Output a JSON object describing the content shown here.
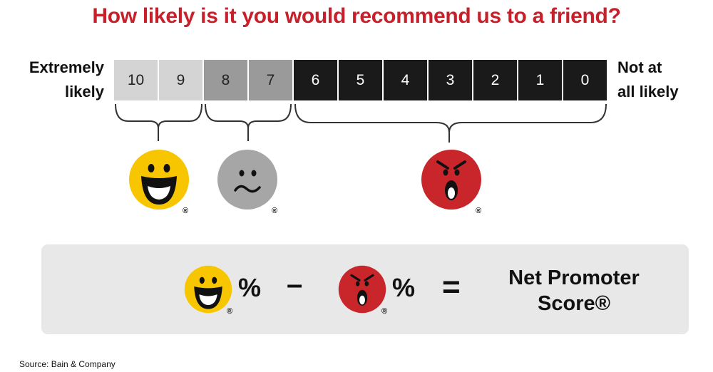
{
  "title": "How likely is it you would recommend us to a friend?",
  "left_label": [
    "Extremely",
    "likely"
  ],
  "right_label": [
    "Not at",
    "all likely"
  ],
  "scale": [
    {
      "value": "10",
      "group": "promoter"
    },
    {
      "value": "9",
      "group": "promoter"
    },
    {
      "value": "8",
      "group": "passive"
    },
    {
      "value": "7",
      "group": "passive"
    },
    {
      "value": "6",
      "group": "detractor"
    },
    {
      "value": "5",
      "group": "detractor"
    },
    {
      "value": "4",
      "group": "detractor"
    },
    {
      "value": "3",
      "group": "detractor"
    },
    {
      "value": "2",
      "group": "detractor"
    },
    {
      "value": "1",
      "group": "detractor"
    },
    {
      "value": "0",
      "group": "detractor"
    }
  ],
  "colors": {
    "promoter_cell": "#d4d4d4",
    "passive_cell": "#9a9a9a",
    "detractor_cell": "#1a1a1a",
    "promoter_face": "#f7c600",
    "passive_face": "#a6a6a6",
    "detractor_face": "#c9262c",
    "title": "#c8202a"
  },
  "icons": {
    "promoter": "happy-face-icon",
    "passive": "neutral-face-icon",
    "detractor": "angry-face-icon"
  },
  "registered_mark": "®",
  "formula": {
    "percent": "%",
    "minus": "–",
    "equals": "=",
    "result": [
      "Net Promoter",
      "Score®"
    ]
  },
  "source": "Source: Bain & Company"
}
